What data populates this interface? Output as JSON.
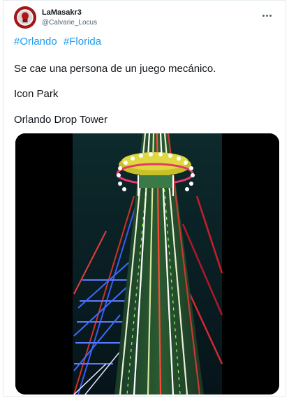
{
  "tweet": {
    "display_name": "LaMasakr3",
    "handle": "@Calvarie_Locus",
    "hashtags": [
      "#Orlando",
      "#Florida"
    ],
    "lines": [
      "Se cae una persona de un juego mecánico.",
      "Icon Park",
      "Orlando Drop Tower"
    ]
  },
  "media": {
    "type": "video",
    "subject": "drop-tower-ride-at-night"
  },
  "icons": {
    "more": "more-options-icon",
    "avatar": "avatar-icon"
  },
  "colors": {
    "link": "#1d9bf0",
    "text": "#0f1419",
    "muted": "#536471"
  }
}
